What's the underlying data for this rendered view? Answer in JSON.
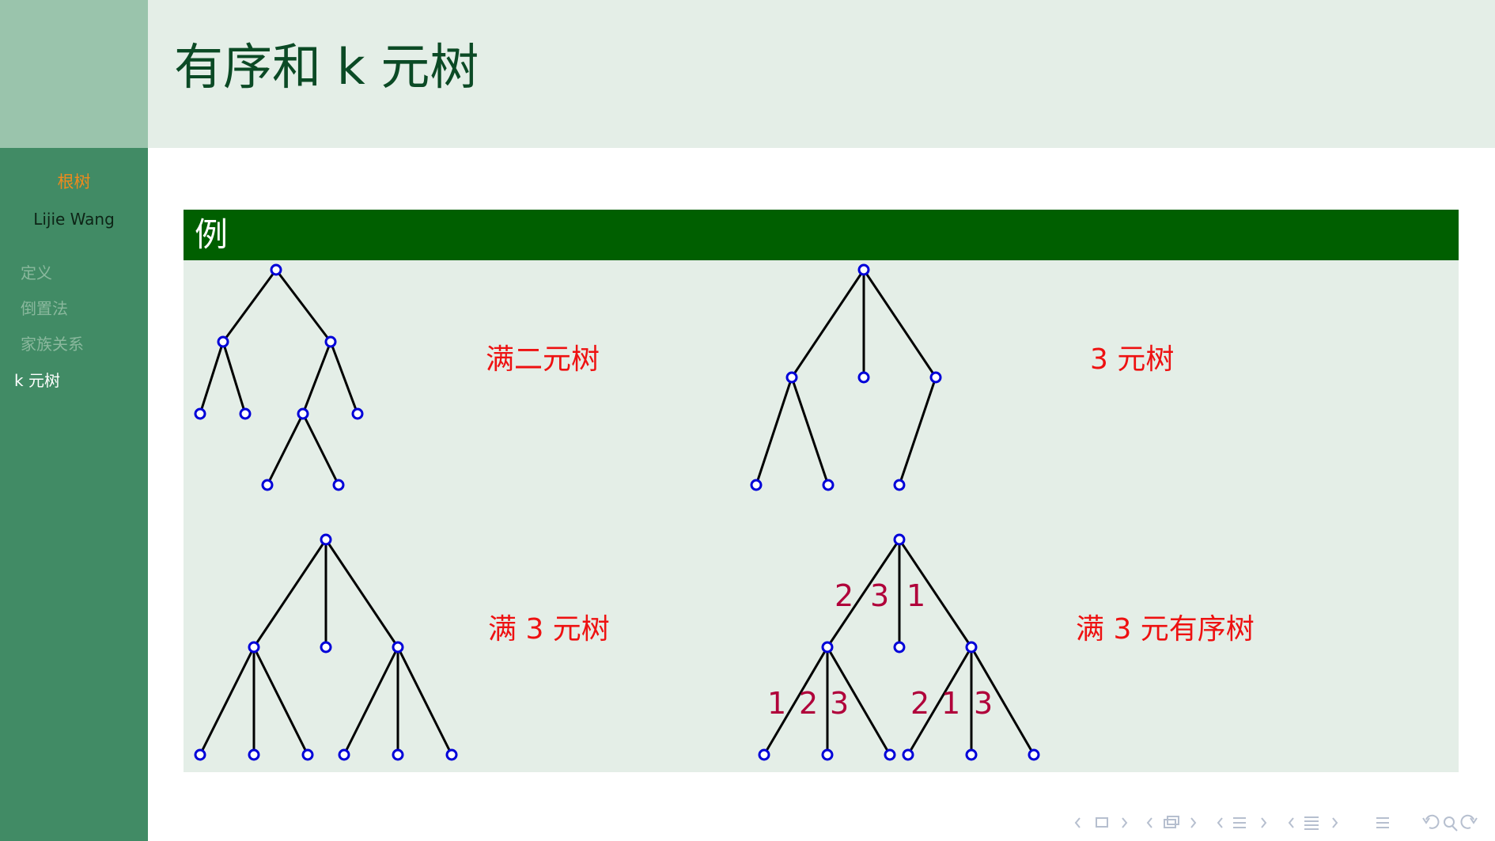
{
  "slide": {
    "title": "有序和 k 元树"
  },
  "sidebar": {
    "title": "根树",
    "author": "Lijie Wang",
    "items": [
      {
        "label": "定义",
        "active": false
      },
      {
        "label": "倒置法",
        "active": false
      },
      {
        "label": "家族关系",
        "active": false
      },
      {
        "label": "k 元树",
        "active": true
      }
    ]
  },
  "block": {
    "title": "例"
  },
  "trees": {
    "full_binary": {
      "label": "满二元树"
    },
    "ternary": {
      "label": "3 元树"
    },
    "full_ternary": {
      "label": "满 3 元树"
    },
    "full_ordered_ternary": {
      "label": "满 3 元有序树",
      "order_labels": [
        "2",
        "3",
        "1",
        "1",
        "2",
        "3",
        "2",
        "1",
        "3"
      ]
    }
  },
  "colors": {
    "sidebar": "#418b65",
    "sidebar_top": "#9ac4ac",
    "header_bg": "#e4eee7",
    "block_header": "#005f00",
    "title_text": "#0b4a25",
    "label_red": "#ee1111",
    "order_label": "#b0003a",
    "node_stroke": "#0000d8"
  },
  "nav_icons": [
    "prev-arrow-icon",
    "frame-icon",
    "next-arrow-icon",
    "subsection-icon",
    "section-icon",
    "document-icon",
    "menu-icon",
    "undo-icon",
    "search-icon",
    "redo-icon"
  ]
}
